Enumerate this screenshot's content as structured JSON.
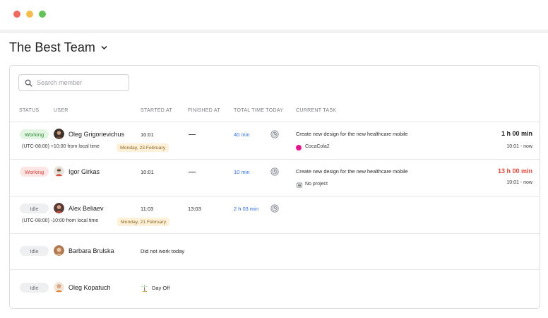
{
  "window": {
    "controls": [
      "close",
      "minimize",
      "maximize"
    ]
  },
  "team": {
    "name": "The Best Team",
    "dropdown_icon": "chevron-down-icon"
  },
  "search": {
    "placeholder": "Search member",
    "icon": "search-icon"
  },
  "columns": {
    "status": "STATUS",
    "user": "USER",
    "started_at": "STARTED AT",
    "finished_at": "FINISHED AT",
    "total_time_today": "TOTAL TIME TODAY",
    "current_task": "CURRENT TASK"
  },
  "colors": {
    "working_green": "#2c8a34",
    "working_red": "#d0473c",
    "link_blue": "#2e6fd6",
    "duration_red": "#e2483c",
    "cocacola_project": "#e5178f"
  },
  "members": [
    {
      "status": "Working",
      "name": "Oleg Grigorievichus",
      "timezone": "(UTC-08:00) +10:00 from local time",
      "date": "Monday, 23 February",
      "started_at": "10:01",
      "finished_at": "—",
      "total_time": "40 min",
      "task": "Create new design for the new healthcare mobile",
      "project": "CocaCola2",
      "duration": "1 h 00 min",
      "range": "10:01 - now"
    },
    {
      "status": "Working",
      "name": "Igor Girkas",
      "started_at": "10:01",
      "finished_at": "—",
      "total_time": "10 min",
      "task": "Create new design for the new healthcare mobile",
      "project": "No project",
      "duration": "13 h 00 min",
      "range": "10:01 - now"
    },
    {
      "status": "Idle",
      "name": "Alex Beliaev",
      "timezone": "(UTC-08:00) -10:00 from local time",
      "date": "Monday, 21 February",
      "started_at": "11:03",
      "finished_at": "13:03",
      "total_time": "2 h 03 min"
    },
    {
      "status": "Idle",
      "name": "Barbara Brulska",
      "note": "Did not work today"
    },
    {
      "status": "Idle",
      "name": "Oleg Kopatuch",
      "note": "Day Off",
      "note_icon": "palm-tree-icon"
    }
  ]
}
